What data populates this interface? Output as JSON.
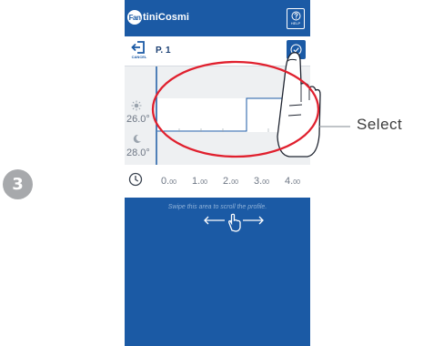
{
  "step_number": "3",
  "app": {
    "logo_text": "tiniCosmi",
    "logo_badge": "Fan",
    "help_label": "HELP"
  },
  "toolbar": {
    "cancel_label": "CANCEL",
    "profile_name": "P. 1"
  },
  "temperatures": {
    "comfort": "26.0°",
    "economy": "28.0°"
  },
  "time_axis": {
    "ticks": [
      {
        "int": "0.",
        "dec": "00"
      },
      {
        "int": "1.",
        "dec": "00"
      },
      {
        "int": "2.",
        "dec": "00"
      },
      {
        "int": "3.",
        "dec": "00"
      },
      {
        "int": "4.",
        "dec": "00"
      }
    ]
  },
  "swipe_hint": "Swipe this area to scroll the profile.",
  "callout": "Select",
  "colors": {
    "brand_blue": "#1b5aa5",
    "callout_red": "#e0202e",
    "chart_bg": "#eef0f2",
    "badge_grey": "#a7a9ac"
  },
  "icons": [
    "help-icon",
    "cancel-icon",
    "confirm-check-icon",
    "sun-icon",
    "moon-icon",
    "clock-icon",
    "swipe-hand-icon"
  ]
}
